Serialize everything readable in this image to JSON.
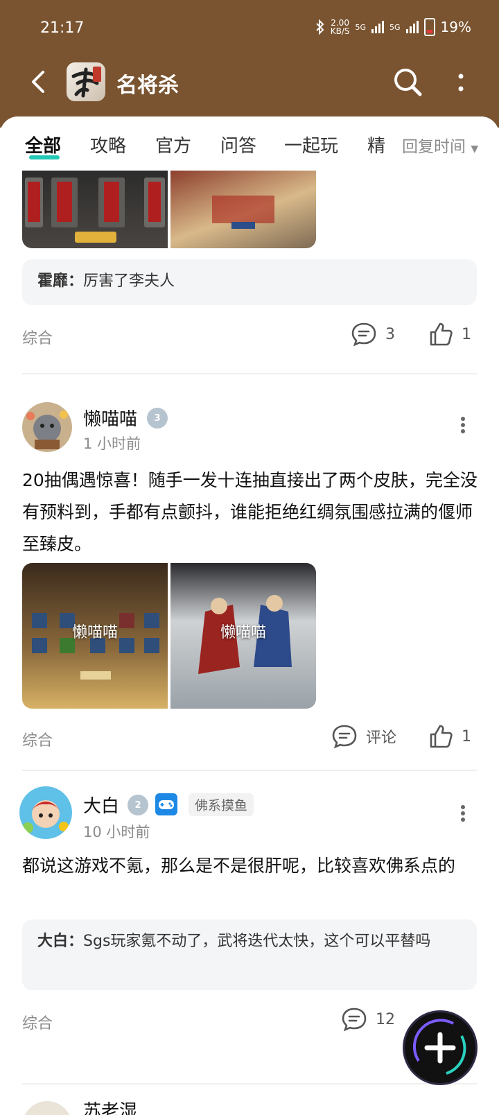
{
  "status_bar": {
    "time": "21:17",
    "net_speed_top": "2.00",
    "net_speed_unit": "KB/S",
    "signal1": "5G",
    "signal2": "5G",
    "battery": "19%"
  },
  "header": {
    "title": "名将杀"
  },
  "tabs": [
    "全部",
    "攻略",
    "官方",
    "问答",
    "一起玩",
    "精"
  ],
  "sort_label": "回复时间",
  "posts": [
    {
      "quote_author": "霍靡：",
      "quote_text": "厉害了李夫人",
      "category": "综合",
      "comments": "3",
      "likes": "1"
    },
    {
      "author": "懒喵喵",
      "level": "3",
      "time": "1 小时前",
      "body": "20抽偶遇惊喜！随手一发十连抽直接出了两个皮肤，完全没有预料到，手都有点颤抖，谁能拒绝红绸氛围感拉满的偃师至臻皮。",
      "watermark1": "懒喵喵",
      "watermark2": "懒喵喵",
      "category": "综合",
      "comments": "评论",
      "likes": "1"
    },
    {
      "author": "大白",
      "level": "2",
      "badge": "佛系摸鱼",
      "time": "10 小时前",
      "body": "都说这游戏不氪，那么是不是很肝呢，比较喜欢佛系点的",
      "quote_author": "大白：",
      "quote_text": "Sgs玩家氪不动了，武将迭代太快，这个可以平替吗",
      "category": "综合",
      "comments": "12"
    },
    {
      "author": "苏老湿"
    }
  ],
  "colors": {
    "header_bg": "#7a5430",
    "accent": "#25c8b4"
  }
}
